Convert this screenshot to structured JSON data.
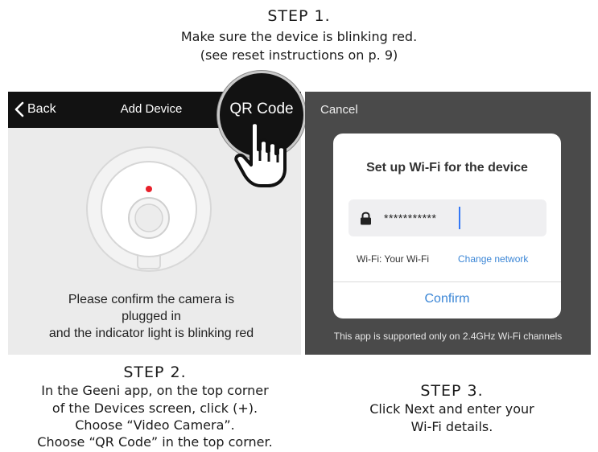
{
  "step1": {
    "title": "STEP 1.",
    "line1": "Make sure the device is blinking red.",
    "line2": "(see reset instructions on p. 9)"
  },
  "add_device_screen": {
    "back_label": "Back",
    "title": "Add Device",
    "qr_code_label": "QR Code",
    "confirm_lines": [
      "Please confirm the camera is",
      "plugged in",
      "and the indicator light is blinking red"
    ],
    "indicator_color": "#e8202a"
  },
  "wifi_screen": {
    "cancel_label": "Cancel",
    "dialog_title": "Set up Wi-Fi for the device",
    "password_value": "***********",
    "wifi_label": "Wi-Fi: Your Wi-Fi",
    "change_network_label": "Change network",
    "confirm_label": "Confirm",
    "support_note": "This app is supported only on 2.4GHz Wi-Fi channels",
    "accent_color": "#3b86d6"
  },
  "step2": {
    "title": "STEP 2.",
    "lines": [
      "In the Geeni app, on the top corner",
      "of the Devices screen, click (+).",
      "Choose “Video Camera”.",
      "Choose “QR Code” in the top corner."
    ]
  },
  "step3": {
    "title": "STEP 3.",
    "lines": [
      "Click Next and enter your",
      "Wi-Fi details."
    ]
  }
}
